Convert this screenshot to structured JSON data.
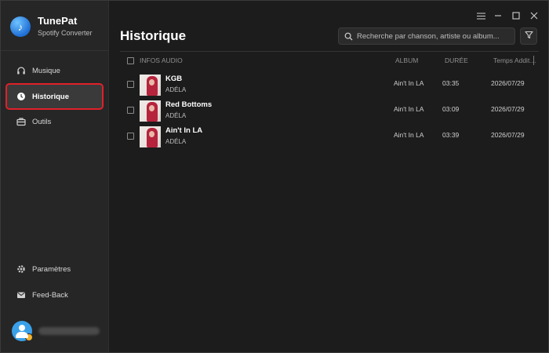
{
  "app": {
    "name": "TunePat",
    "subtitle": "Spotify Converter"
  },
  "sidebar": {
    "items": [
      {
        "label": "Musique",
        "icon": "headphones-icon"
      },
      {
        "label": "Historique",
        "icon": "clock-icon",
        "active": true
      },
      {
        "label": "Outils",
        "icon": "toolbox-icon"
      }
    ],
    "bottom_items": [
      {
        "label": "Paramètres",
        "icon": "gear-icon"
      },
      {
        "label": "Feed-Back",
        "icon": "mail-icon"
      }
    ]
  },
  "header": {
    "title": "Historique",
    "search_placeholder": "Recherche par chanson, artiste ou album..."
  },
  "table": {
    "columns": [
      "INFOS AUDIO",
      "ALBUM",
      "DURÉE",
      "Temps Addition..."
    ],
    "rows": [
      {
        "title": "KGB",
        "artist": "ADÉLA",
        "album": "Ain't In LA",
        "duration": "03:35",
        "date": "2026/07/29"
      },
      {
        "title": "Red Bottoms",
        "artist": "ADÉLA",
        "album": "Ain't In LA",
        "duration": "03:09",
        "date": "2026/07/29"
      },
      {
        "title": "Ain't In LA",
        "artist": "ADÉLA",
        "album": "Ain't In LA",
        "duration": "03:39",
        "date": "2026/07/29"
      }
    ]
  },
  "colors": {
    "accent_highlight": "#e0202a",
    "brand_blue": "#1f6fd6",
    "background": "#1c1c1c",
    "sidebar": "#262626"
  }
}
